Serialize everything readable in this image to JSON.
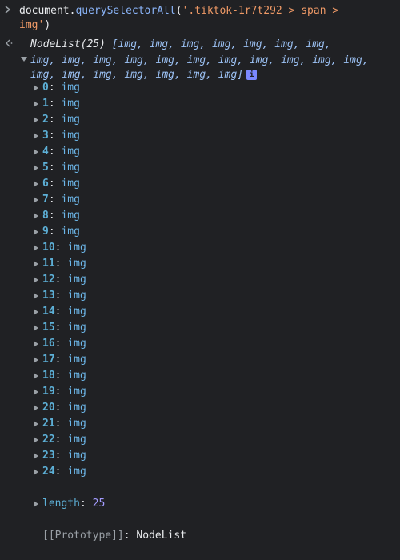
{
  "command": {
    "prompt_icon": "chevron-right-icon",
    "part_plain": "document.",
    "part_method": "querySelectorAll",
    "part_paren": "(",
    "part_string_1": "'.tiktok-1r7t292 > span >",
    "part_string_2": "img'",
    "part_close": ")"
  },
  "result": {
    "return_icon": "return-arrow-icon",
    "summary_name": "NodeList(25) ",
    "summary_line1": "[img, img, img, img, img, img, img,",
    "summary_line2": "img, img, img, img, img, img, img, img, img, img, img,",
    "summary_line3": "img, img, img, img, img, img, img]",
    "info_badge": "i",
    "items": [
      {
        "index": "0",
        "value": "img"
      },
      {
        "index": "1",
        "value": "img"
      },
      {
        "index": "2",
        "value": "img"
      },
      {
        "index": "3",
        "value": "img"
      },
      {
        "index": "4",
        "value": "img"
      },
      {
        "index": "5",
        "value": "img"
      },
      {
        "index": "6",
        "value": "img"
      },
      {
        "index": "7",
        "value": "img"
      },
      {
        "index": "8",
        "value": "img"
      },
      {
        "index": "9",
        "value": "img"
      },
      {
        "index": "10",
        "value": "img"
      },
      {
        "index": "11",
        "value": "img"
      },
      {
        "index": "12",
        "value": "img"
      },
      {
        "index": "13",
        "value": "img"
      },
      {
        "index": "14",
        "value": "img"
      },
      {
        "index": "15",
        "value": "img"
      },
      {
        "index": "16",
        "value": "img"
      },
      {
        "index": "17",
        "value": "img"
      },
      {
        "index": "18",
        "value": "img"
      },
      {
        "index": "19",
        "value": "img"
      },
      {
        "index": "20",
        "value": "img"
      },
      {
        "index": "21",
        "value": "img"
      },
      {
        "index": "22",
        "value": "img"
      },
      {
        "index": "23",
        "value": "img"
      },
      {
        "index": "24",
        "value": "img"
      }
    ],
    "length_key": "length",
    "length_value": "25",
    "proto_key": "[[Prototype]]",
    "proto_value": "NodeList"
  },
  "colors": {
    "background": "#202124",
    "index_key": "#5db0d7",
    "string": "#ee9966",
    "number": "#a39bff"
  }
}
